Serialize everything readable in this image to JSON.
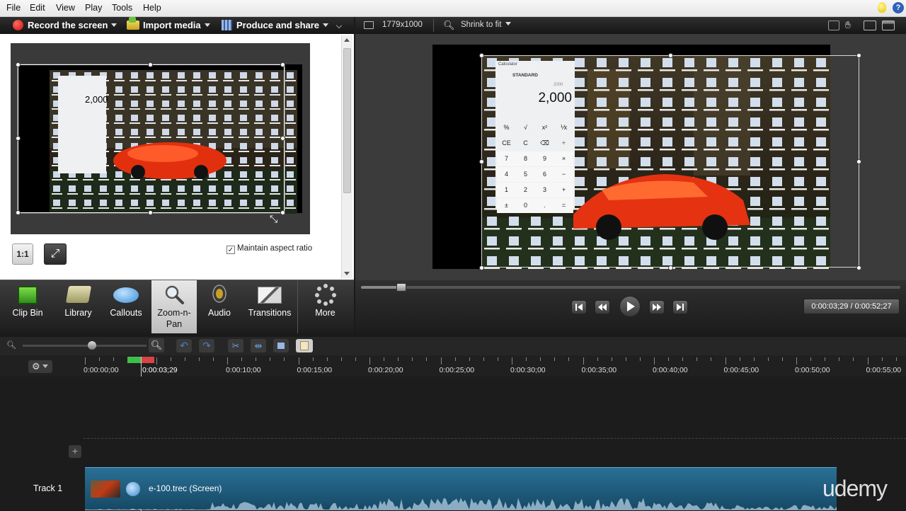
{
  "menu": {
    "items": [
      "File",
      "Edit",
      "View",
      "Play",
      "Tools",
      "Help"
    ]
  },
  "toolbar": {
    "record": "Record the screen",
    "import": "Import media",
    "produce": "Produce and share"
  },
  "left_panel": {
    "zoom_1to1": "1:1",
    "maintain_aspect": "Maintain aspect ratio",
    "maintain_checked": true,
    "calc_value": "2,000"
  },
  "tool_tabs": [
    {
      "label": "Clip Bin",
      "icon": "film-icon"
    },
    {
      "label": "Library",
      "icon": "folder-icon"
    },
    {
      "label": "Callouts",
      "icon": "speech-bubble-icon"
    },
    {
      "label": "Zoom-n-Pan",
      "icon": "magnifier-icon",
      "active": true
    },
    {
      "label": "Audio",
      "icon": "speaker-icon"
    },
    {
      "label": "Transitions",
      "icon": "transition-icon"
    },
    {
      "label": "More",
      "icon": "dots-icon"
    }
  ],
  "preview": {
    "dimensions": "1779x1000",
    "fit_mode": "Shrink to fit",
    "calc_title": "Calculator",
    "calc_mode": "STANDARD",
    "calc_small": "2000",
    "calc_value": "2,000",
    "calc_keys": [
      "%",
      "√",
      "x²",
      "⅟x",
      "CE",
      "C",
      "⌫",
      "÷",
      "7",
      "8",
      "9",
      "×",
      "4",
      "5",
      "6",
      "−",
      "1",
      "2",
      "3",
      "+",
      "±",
      "0",
      ".",
      "="
    ]
  },
  "player": {
    "time": "0:00:03;29 / 0:00:52;27",
    "progress": 0.075
  },
  "timeline": {
    "playhead_time": "0:00:03;29",
    "ticks": [
      "0:00:00;00",
      "0:00:10;00",
      "0:00:15;00",
      "0:00:20;00",
      "0:00:25;00",
      "0:00:30;00",
      "0:00:35;00",
      "0:00:40;00",
      "0:00:45;00",
      "0:00:50;00",
      "0:00:55;00"
    ],
    "track_label": "Track 1",
    "clip_name": "e-100.trec (Screen)"
  },
  "watermark": "udemy",
  "colors": {
    "accent": "#2a6f95",
    "record": "#e52620"
  }
}
